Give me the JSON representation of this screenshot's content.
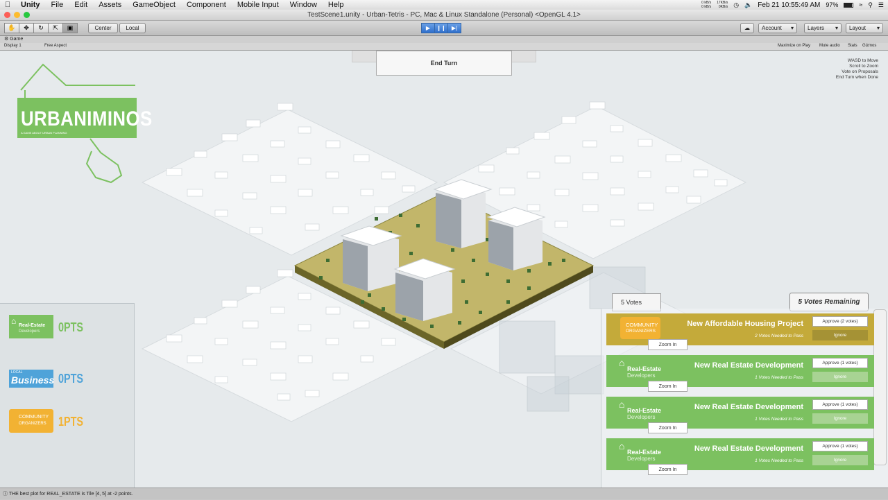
{
  "menubar": {
    "apple": "",
    "items": [
      "Unity",
      "File",
      "Edit",
      "Assets",
      "GameObject",
      "Component",
      "Mobile Input",
      "Window",
      "Help"
    ],
    "net_up": "0 kB/s",
    "net_down": "0 kB/s",
    "net2_up": "17KB/s",
    "net2_down": "0KB/s",
    "date": "Feb 21  10:55:49 AM",
    "battery": "97%"
  },
  "window": {
    "title": "TestScene1.unity - Urban-Tetris - PC, Mac & Linux Standalone (Personal) <OpenGL 4.1>"
  },
  "toolbar": {
    "pivot": "Center",
    "space": "Local",
    "account": "Account",
    "layers": "Layers",
    "layout": "Layout"
  },
  "game_tab": {
    "label": "Game",
    "display": "Display 1",
    "aspect": "Free Aspect",
    "maximize": "Maximize on Play",
    "mute": "Mute audio",
    "stats": "Stats",
    "gizmos": "Gizmos"
  },
  "hud": {
    "end_turn": "End Turn",
    "help": [
      "WASD to Move",
      "Scroll to Zoom",
      "Vote on Proposals",
      "End Turn when Done"
    ],
    "logo_title": "URBANIMINOS",
    "logo_sub": "A GAME ABOUT URBAN PLANNING",
    "votes": "5 Votes",
    "votes_remaining": "5 Votes Remaining"
  },
  "scores": [
    {
      "name": "Real-Estate",
      "name2": "Developers",
      "points": "0PTS",
      "color": "#7cc160"
    },
    {
      "name": "LOCAL",
      "name2": "Business",
      "points": "0PTS",
      "color": "#4fa3d9"
    },
    {
      "name": "COMMUNITY",
      "name2": "ORGANIZERS",
      "points": "1PTS",
      "color": "#f2b233"
    }
  ],
  "proposals": [
    {
      "badge1": "COMMUNITY",
      "badge2": "ORGANIZERS",
      "title": "New Affordable Housing Project",
      "need": "2 Votes Needed to Pass",
      "approve": "Approve (2 votes)",
      "ignore": "Ignore",
      "zoom": "Zoom In",
      "color": "#c4aa3a"
    },
    {
      "badge1": "Real-Estate",
      "badge2": "Developers",
      "title": "New Real Estate Development",
      "need": "1 Votes Needed to Pass",
      "approve": "Approve (1 votes)",
      "ignore": "Ignore",
      "zoom": "Zoom In",
      "color": "#7cc160"
    },
    {
      "badge1": "Real-Estate",
      "badge2": "Developers",
      "title": "New Real Estate Development",
      "need": "1 Votes Needed to Pass",
      "approve": "Approve (1 votes)",
      "ignore": "Ignore",
      "zoom": "Zoom In",
      "color": "#7cc160"
    },
    {
      "badge1": "Real-Estate",
      "badge2": "Developers",
      "title": "New Real Estate Development",
      "need": "1 Votes Needed to Pass",
      "approve": "Approve (1 votes)",
      "ignore": "Ignore",
      "zoom": "Zoom In",
      "color": "#7cc160"
    }
  ],
  "status": "THE best plot for REAL_ESTATE is Tile [4, 5] at -2 points."
}
